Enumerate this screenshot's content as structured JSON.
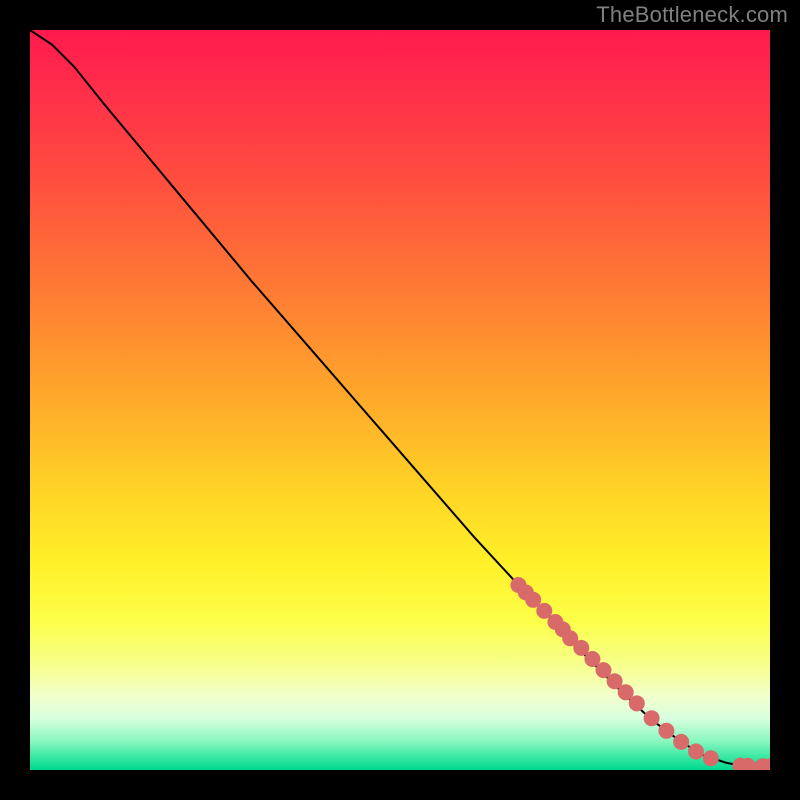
{
  "attribution": "TheBottleneck.com",
  "colors": {
    "frame": "#000000",
    "text": "#808080",
    "curve": "#000000",
    "marker_fill": "#d86a6a",
    "gradient_stops": [
      {
        "offset": 0.0,
        "color": "#ff1a4d"
      },
      {
        "offset": 0.08,
        "color": "#ff2e4a"
      },
      {
        "offset": 0.2,
        "color": "#ff4d3f"
      },
      {
        "offset": 0.35,
        "color": "#ff7a34"
      },
      {
        "offset": 0.5,
        "color": "#ffaa2a"
      },
      {
        "offset": 0.62,
        "color": "#ffd326"
      },
      {
        "offset": 0.72,
        "color": "#fff028"
      },
      {
        "offset": 0.8,
        "color": "#fcff4a"
      },
      {
        "offset": 0.86,
        "color": "#f7ff8f"
      },
      {
        "offset": 0.9,
        "color": "#f2ffcc"
      },
      {
        "offset": 0.93,
        "color": "#d8ffdf"
      },
      {
        "offset": 0.96,
        "color": "#8cf7c0"
      },
      {
        "offset": 0.985,
        "color": "#30e6a0"
      },
      {
        "offset": 1.0,
        "color": "#00d98f"
      }
    ]
  },
  "chart_data": {
    "type": "line",
    "title": "",
    "xlabel": "",
    "ylabel": "",
    "xlim": [
      0,
      100
    ],
    "ylim": [
      0,
      100
    ],
    "grid": false,
    "legend": false,
    "series": [
      {
        "name": "curve",
        "x": [
          0,
          3,
          6,
          10,
          15,
          20,
          30,
          40,
          50,
          60,
          66,
          70,
          75,
          80,
          84,
          88,
          91,
          94,
          96,
          98,
          100
        ],
        "y": [
          100,
          98,
          95,
          90,
          84,
          78,
          66,
          54.5,
          43,
          31.5,
          25,
          21,
          15.5,
          10.5,
          6.8,
          3.8,
          2,
          1,
          0.6,
          0.5,
          0.5
        ]
      }
    ],
    "markers": {
      "name": "highlighted-points",
      "x": [
        66,
        67,
        68,
        69.5,
        71,
        72,
        73,
        74.5,
        76,
        77.5,
        79,
        80.5,
        82,
        84,
        86,
        88,
        90,
        92,
        96,
        97,
        99,
        100
      ],
      "y": [
        25,
        24,
        23,
        21.5,
        20,
        19,
        17.8,
        16.5,
        15,
        13.5,
        12,
        10.5,
        9,
        7,
        5.3,
        3.8,
        2.5,
        1.6,
        0.6,
        0.55,
        0.5,
        0.5
      ]
    }
  }
}
